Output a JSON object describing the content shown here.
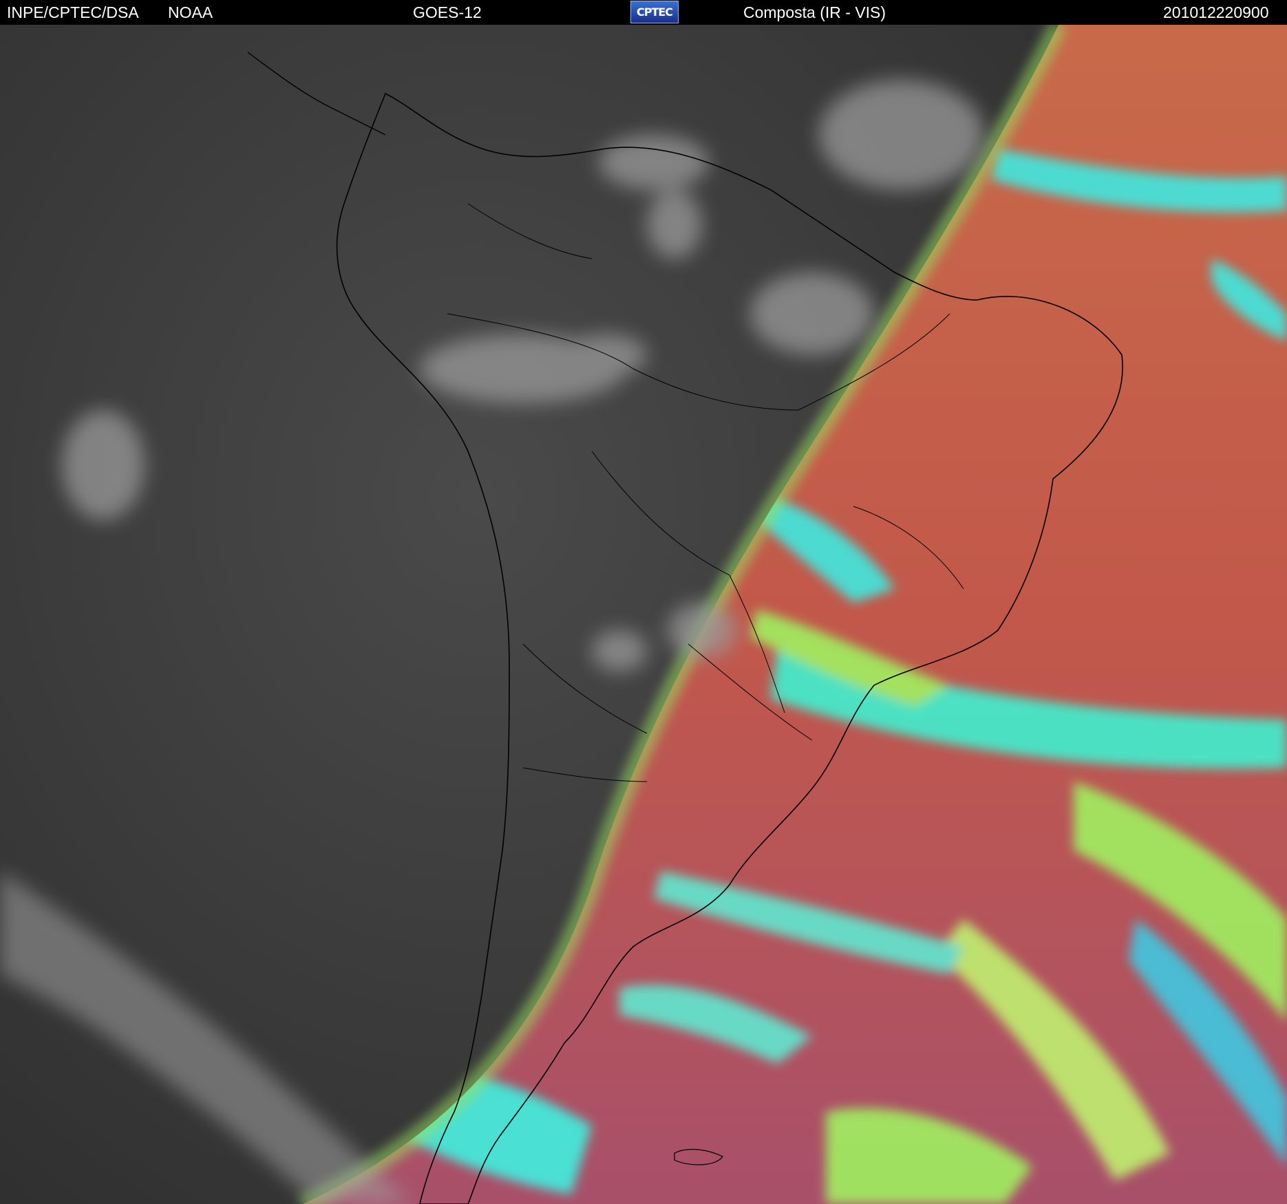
{
  "header": {
    "institution": "INPE/CPTEC/DSA",
    "agency": "NOAA",
    "satellite": "GOES-12",
    "logo_text": "CPTEC",
    "product": "Composta (IR - VIS)",
    "timestamp": "201012220900"
  },
  "colors": {
    "night_side": "#3a3a3a",
    "day_ocean": "#c0584a",
    "cloud_cyan": "#40f0d0",
    "cloud_green": "#a0f060",
    "coastline": "#000000"
  }
}
